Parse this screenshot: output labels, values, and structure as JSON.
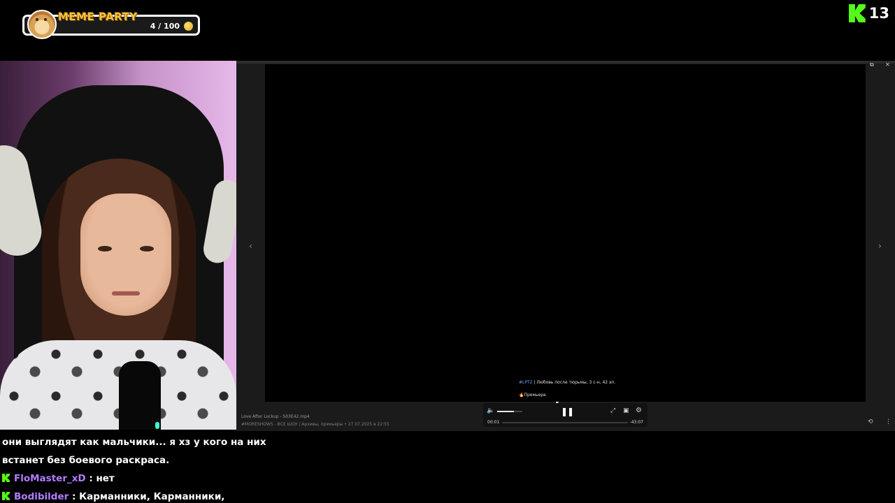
{
  "meme_badge": {
    "title": "MEME PARTY",
    "progress": "4 / 100"
  },
  "kick": {
    "viewer_count": "13"
  },
  "viewer": {
    "window_controls": [
      "–",
      "⧉",
      "✕"
    ],
    "prev_arrow": "‹",
    "next_arrow": "›",
    "caption": {
      "tag": "#LPT2",
      "text": " | Любовь после тюрьмы, 3 с-н, 42 эп.",
      "badge": "Премьера"
    },
    "file": {
      "name": "Love After Lockup - S03E42.mp4",
      "meta": "#MORESHOWS - ВСЕ ШОУ | Архивы, премьеры • 27.07.2025 в 22:55"
    },
    "player": {
      "current_time": "00:01",
      "remaining_time": "-43:07",
      "volume_fraction": 0.67
    }
  },
  "chat": {
    "lines": [
      {
        "text": "они выглядят как мальчики... я хз у кого на них"
      },
      {
        "text": "встанет без боевого раскраса."
      }
    ],
    "messages": [
      {
        "user": "FloMaster_xD",
        "separator": " : ",
        "text": "нет"
      },
      {
        "user": "Bodibilder",
        "separator": " : ",
        "text": "Карманники, Карманники,"
      }
    ]
  },
  "colors": {
    "kick_green": "#53fc18",
    "username": "#b27cff",
    "meme_title": "#f6c43c"
  }
}
